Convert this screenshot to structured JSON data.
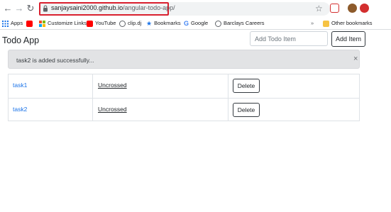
{
  "browser": {
    "url_host": "sanjaysaini2000.github.io",
    "url_path": "/angular-todo-app/",
    "bookmarks": [
      {
        "label": "Apps",
        "icon": "apps-grid-icon",
        "color": "#5f6368"
      },
      {
        "label": "",
        "icon": "youtube-icon",
        "color": "#ff0000"
      },
      {
        "label": "Customize Links",
        "icon": "windows-icon",
        "color": "#f25022"
      },
      {
        "label": "YouTube",
        "icon": "youtube-icon",
        "color": "#ff0000"
      },
      {
        "label": "clip.dj",
        "icon": "globe-icon",
        "color": "#5f6368"
      },
      {
        "label": "Bookmarks",
        "icon": "star-icon",
        "color": "#1a73e8"
      },
      {
        "label": "Google",
        "icon": "google-icon",
        "color": "#4285f4"
      },
      {
        "label": "Barclays Careers",
        "icon": "globe-icon",
        "color": "#5f6368"
      }
    ],
    "overflow": "»",
    "other_bookmarks": "Other bookmarks"
  },
  "app": {
    "title": "Todo App",
    "input_placeholder": "Add Todo Item",
    "add_button": "Add Item"
  },
  "alert": {
    "message": "task2 is added successfully...",
    "close": "×"
  },
  "todos": [
    {
      "task": "task1",
      "status": "Uncrossed",
      "action": "Delete"
    },
    {
      "task": "task2",
      "status": "Uncrossed",
      "action": "Delete"
    }
  ],
  "colors": {
    "highlight": "#d9202f",
    "link": "#1a73e8",
    "alert_bg": "#e2e3e5"
  }
}
